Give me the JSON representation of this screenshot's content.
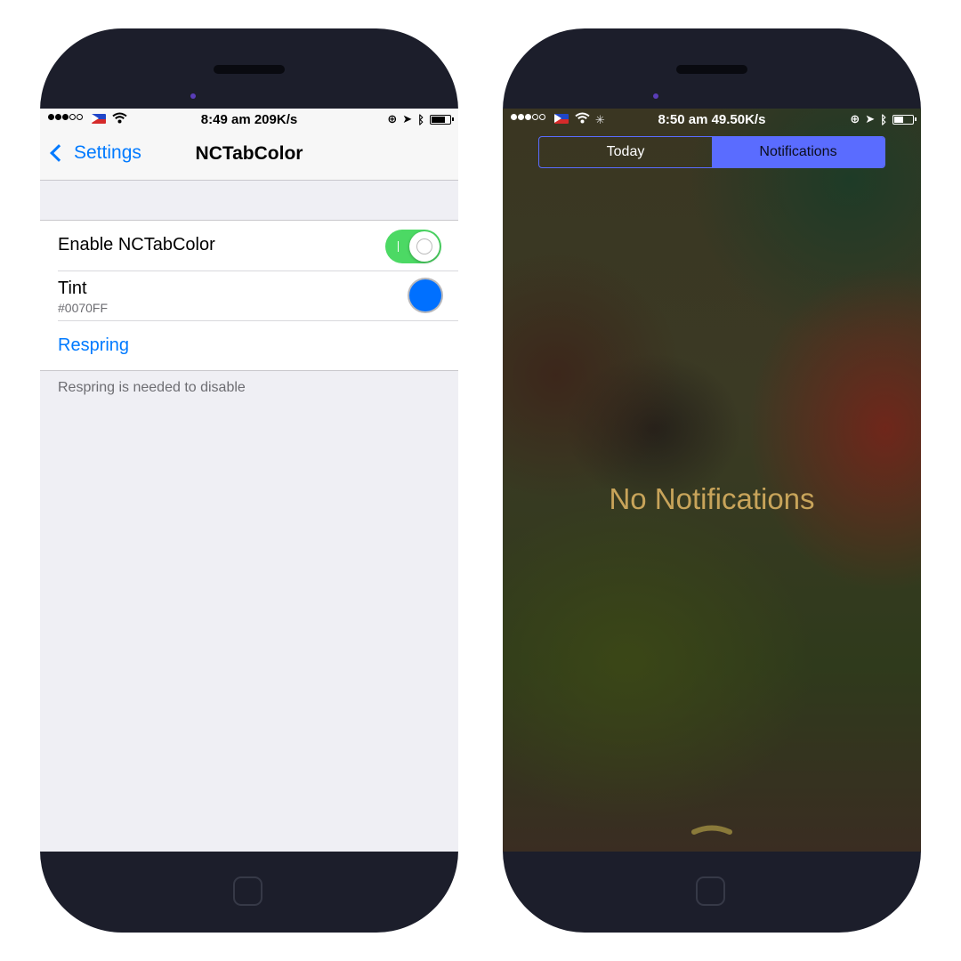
{
  "left": {
    "status": {
      "time_text": "8:49 am 209K/s"
    },
    "nav": {
      "back_label": "Settings",
      "title": "NCTabColor"
    },
    "cells": {
      "enable_label": "Enable NCTabColor",
      "enable_on": true,
      "tint_label": "Tint",
      "tint_value": "#0070FF",
      "respring_label": "Respring"
    },
    "footer_text": "Respring is needed to disable"
  },
  "right": {
    "status": {
      "time_text": "8:50 am 49.50K/s"
    },
    "tabs": [
      {
        "label": "Today",
        "active": false
      },
      {
        "label": "Notifications",
        "active": true
      }
    ],
    "empty_message": "No Notifications"
  },
  "colors": {
    "ios_blue": "#007aff",
    "switch_on": "#4cd964",
    "tint_swatch": "#0070FF",
    "segment_accent": "#5a6cff",
    "empty_text": "#c8a45a"
  }
}
